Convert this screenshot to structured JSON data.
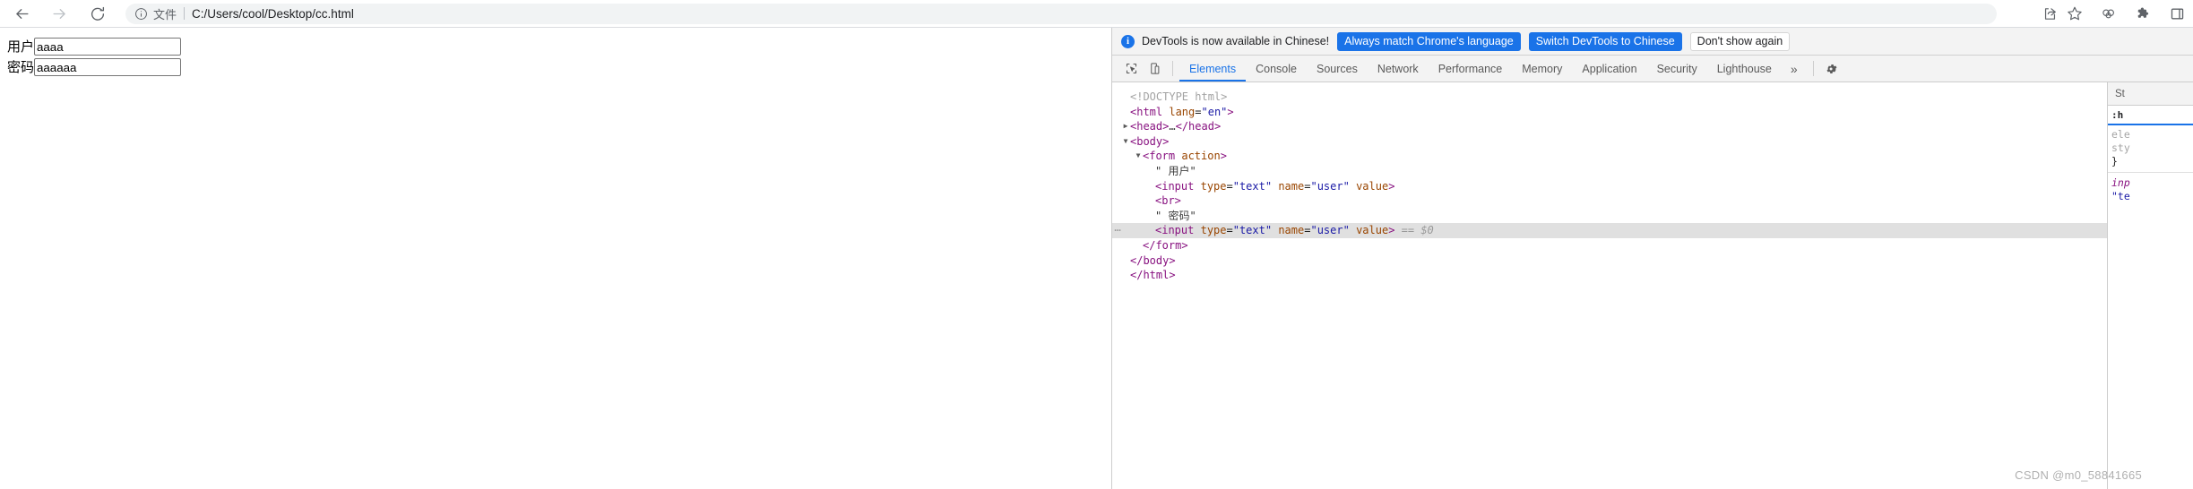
{
  "browser": {
    "back_icon": "arrow-left-icon",
    "forward_icon": "arrow-right-icon",
    "reload_icon": "reload-icon",
    "omnibox": {
      "info_icon": "info-circle-icon",
      "scheme_label": "文件",
      "url": "C:/Users/cool/Desktop/cc.html"
    },
    "toolbar_icons": [
      {
        "name": "share-icon"
      },
      {
        "name": "bookmark-star-icon"
      },
      {
        "name": "profile-circles-icon"
      },
      {
        "name": "extensions-puzzle-icon"
      },
      {
        "name": "side-panel-icon"
      }
    ]
  },
  "page": {
    "fields": [
      {
        "label": "用户",
        "value": "aaaa",
        "name": "user"
      },
      {
        "label": "密码",
        "value": "aaaaaa",
        "name": "user"
      }
    ]
  },
  "devtools": {
    "infobar": {
      "icon": "info-icon",
      "badge": "i",
      "message": "DevTools is now available in Chinese!",
      "buttons": [
        {
          "label": "Always match Chrome's language",
          "style": "primary"
        },
        {
          "label": "Switch DevTools to Chinese",
          "style": "primary"
        },
        {
          "label": "Don't show again",
          "style": "plain"
        }
      ]
    },
    "toolbar": {
      "inspect_icon": "inspect-element-icon",
      "device_icon": "device-toolbar-icon",
      "more_tabs": "»",
      "settings_icon": "gear-icon"
    },
    "tabs": [
      {
        "label": "Elements",
        "active": true
      },
      {
        "label": "Console",
        "active": false
      },
      {
        "label": "Sources",
        "active": false
      },
      {
        "label": "Network",
        "active": false
      },
      {
        "label": "Performance",
        "active": false
      },
      {
        "label": "Memory",
        "active": false
      },
      {
        "label": "Application",
        "active": false
      },
      {
        "label": "Security",
        "active": false
      },
      {
        "label": "Lighthouse",
        "active": false
      }
    ],
    "dom_tree": {
      "lines": [
        {
          "indent": 0,
          "twisty": "",
          "html": "<span class=\"tok-doctype\">&lt;!DOCTYPE html&gt;</span>"
        },
        {
          "indent": 0,
          "twisty": "",
          "html": "<span class=\"tok-punct\">&lt;html</span> <span class=\"tok-attr\">lang</span>=<span class=\"tok-val\">\"en\"</span><span class=\"tok-punct\">&gt;</span>"
        },
        {
          "indent": 0,
          "twisty": "▶",
          "html": "<span class=\"tok-punct\">&lt;head&gt;</span><span class=\"tok-text\">…</span><span class=\"tok-punct\">&lt;/head&gt;</span>"
        },
        {
          "indent": 0,
          "twisty": "▼",
          "html": "<span class=\"tok-punct\">&lt;body&gt;</span>"
        },
        {
          "indent": 1,
          "twisty": "▼",
          "html": "<span class=\"tok-punct\">&lt;form</span> <span class=\"tok-attr\">action</span><span class=\"tok-punct\">&gt;</span>"
        },
        {
          "indent": 2,
          "twisty": "",
          "html": "<span class=\"tok-text\">\" 用户\"</span>"
        },
        {
          "indent": 2,
          "twisty": "",
          "html": "<span class=\"tok-punct\">&lt;input</span> <span class=\"tok-attr\">type</span>=<span class=\"tok-val\">\"text\"</span> <span class=\"tok-attr\">name</span>=<span class=\"tok-val\">\"user\"</span> <span class=\"tok-attr\">value</span><span class=\"tok-punct\">&gt;</span>"
        },
        {
          "indent": 2,
          "twisty": "",
          "html": "<span class=\"tok-punct\">&lt;br&gt;</span>"
        },
        {
          "indent": 2,
          "twisty": "",
          "html": "<span class=\"tok-text\">\" 密码\"</span>"
        },
        {
          "indent": 2,
          "twisty": "",
          "selected": true,
          "gutter": "⋯",
          "html": "<span class=\"tok-punct\">&lt;input</span> <span class=\"tok-attr\">type</span>=<span class=\"tok-val\">\"text\"</span> <span class=\"tok-attr\">name</span>=<span class=\"tok-val\">\"user\"</span> <span class=\"tok-attr\">value</span><span class=\"tok-punct\">&gt;</span> <span class=\"tok-ref\">== $0</span>"
        },
        {
          "indent": 1,
          "twisty": "",
          "html": "<span class=\"tok-punct\">&lt;/form&gt;</span>"
        },
        {
          "indent": 0,
          "twisty": "",
          "html": "<span class=\"tok-punct\">&lt;/body&gt;</span>"
        },
        {
          "indent": 0,
          "twisty": "",
          "html": "<span class=\"tok-punct\">&lt;/html&gt;</span>"
        }
      ]
    },
    "styles_panel": {
      "header_label": "St",
      "filter_pseudo": ":h",
      "rule_selector": "ele",
      "rule_prop": "sty",
      "rule_close": "}",
      "ua_selector": "inp",
      "ua_value": "\"te"
    }
  },
  "watermark": "CSDN @m0_58841665"
}
